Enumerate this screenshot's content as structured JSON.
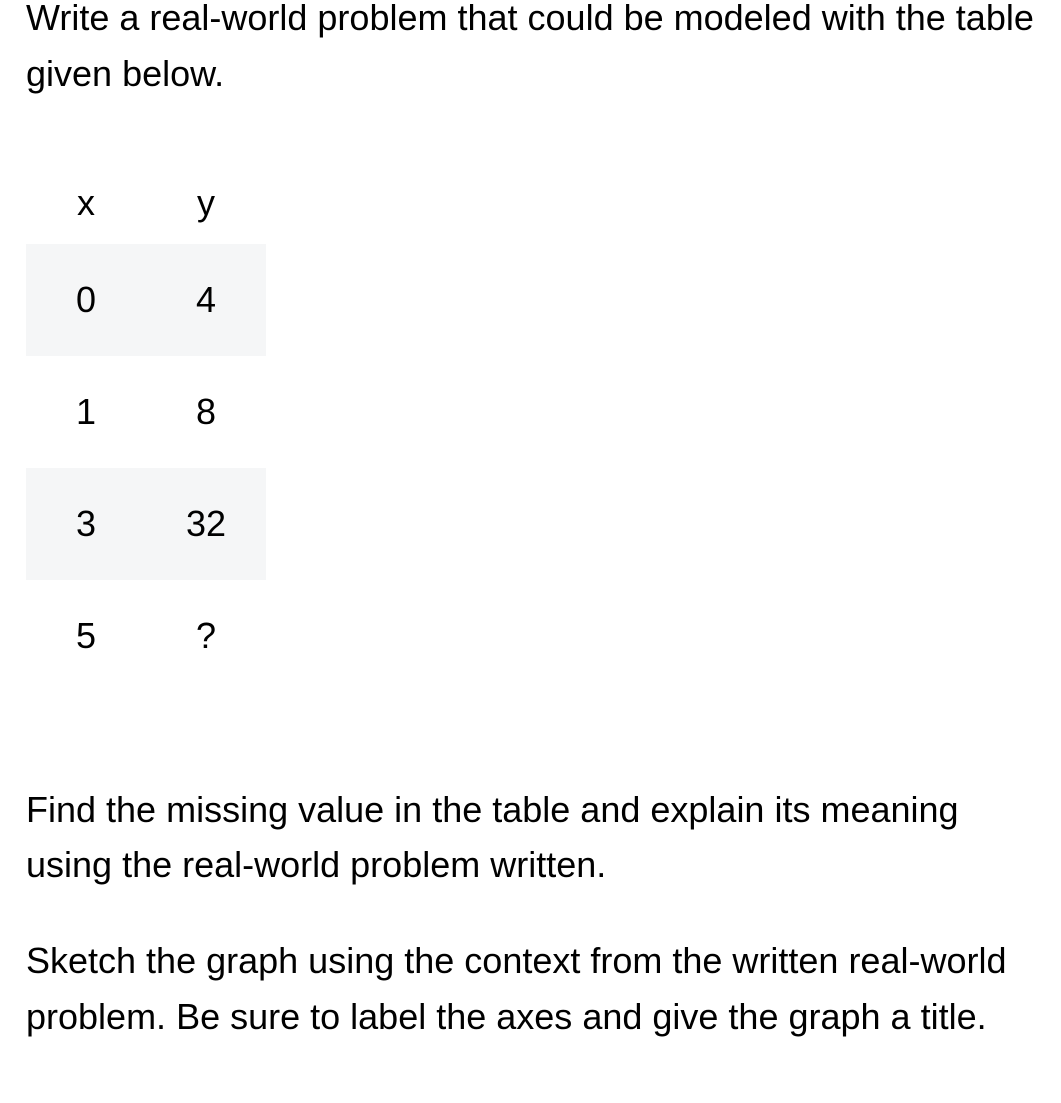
{
  "prompt_top": "Write a real-world problem that could be modeled with the table given below.",
  "table": {
    "headers": {
      "col1": "x",
      "col2": "y"
    },
    "rows": [
      {
        "x": "0",
        "y": "4"
      },
      {
        "x": "1",
        "y": "8"
      },
      {
        "x": "3",
        "y": "32"
      },
      {
        "x": "5",
        "y": "?"
      }
    ]
  },
  "prompt_find": "Find the missing value in the table and explain its meaning using the real-world problem written.",
  "prompt_sketch": "Sketch the graph using the context from the written real-world problem. Be sure to label the axes and give the graph a title."
}
